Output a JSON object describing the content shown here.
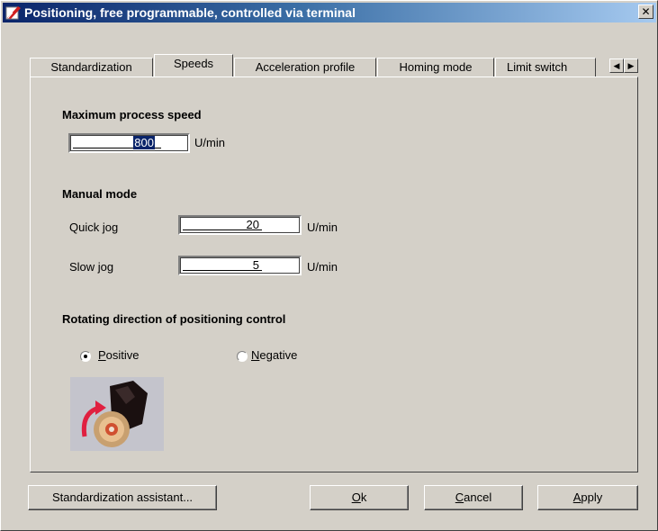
{
  "window": {
    "title": "Positioning, free programmable, controlled via terminal",
    "close_glyph": "✕"
  },
  "tabs": [
    {
      "label": "Standardization",
      "active": false
    },
    {
      "label": "Speeds",
      "active": true
    },
    {
      "label": "Acceleration profile",
      "active": false
    },
    {
      "label": "Homing mode",
      "active": false
    },
    {
      "label": "Limit switch",
      "active": false
    }
  ],
  "tab_scroll": {
    "left_glyph": "◀",
    "right_glyph": "▶"
  },
  "max_speed": {
    "heading": "Maximum process speed",
    "value": "800",
    "unit": "U/min"
  },
  "manual_mode": {
    "heading": "Manual mode",
    "quick_jog": {
      "label": "Quick jog",
      "value": "20",
      "unit": "U/min"
    },
    "slow_jog": {
      "label": "Slow jog",
      "value": "5",
      "unit": "U/min"
    }
  },
  "rotation": {
    "heading": "Rotating direction of positioning control",
    "positive": {
      "first": "P",
      "rest": "ositive",
      "selected": true
    },
    "negative": {
      "first": "N",
      "rest": "egative",
      "selected": false
    }
  },
  "buttons": {
    "assistant": "Standardization assistant...",
    "ok": {
      "first": "O",
      "rest": "k"
    },
    "cancel": {
      "first": "C",
      "rest": "ancel"
    },
    "apply": {
      "first": "A",
      "rest": "pply"
    }
  },
  "icons": {
    "app": "app-logo-icon",
    "motor": "motor-rotation-icon"
  },
  "colors": {
    "title_start": "#0a246a",
    "title_end": "#a6caf0",
    "face": "#d4d0c8",
    "selection": "#0a246a"
  }
}
